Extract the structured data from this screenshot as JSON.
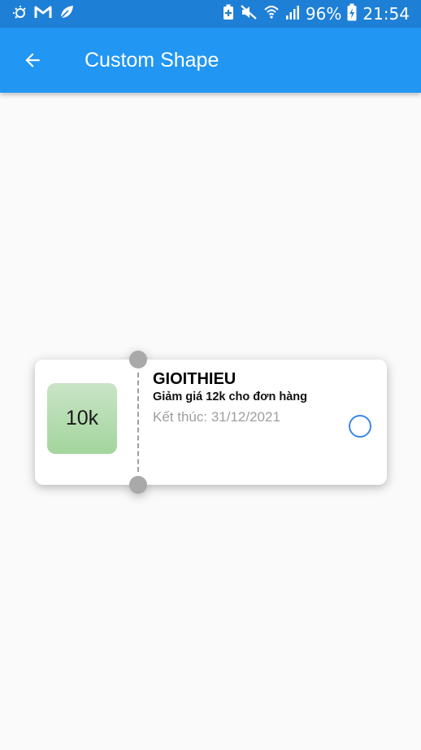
{
  "status_bar": {
    "left_icons": [
      "brightness-icon",
      "gmail-icon",
      "leaf-icon"
    ],
    "right_icons": [
      "battery-saver-icon",
      "mute-icon",
      "wifi-icon",
      "signal-icon"
    ],
    "battery_percent": "96%",
    "time": "21:54",
    "color": "#1e7fd6"
  },
  "app_bar": {
    "title": "Custom Shape",
    "back_icon": "arrow-back-icon",
    "color": "#2196f3"
  },
  "coupon": {
    "amount": "10k",
    "code": "GIOITHIEU",
    "description": "Giảm giá 12k cho đơn hàng",
    "expiry": "Kết thúc: 31/12/2021",
    "selected": false,
    "badge_color": "#a9d7a4",
    "radio_color": "#3d87e8"
  }
}
